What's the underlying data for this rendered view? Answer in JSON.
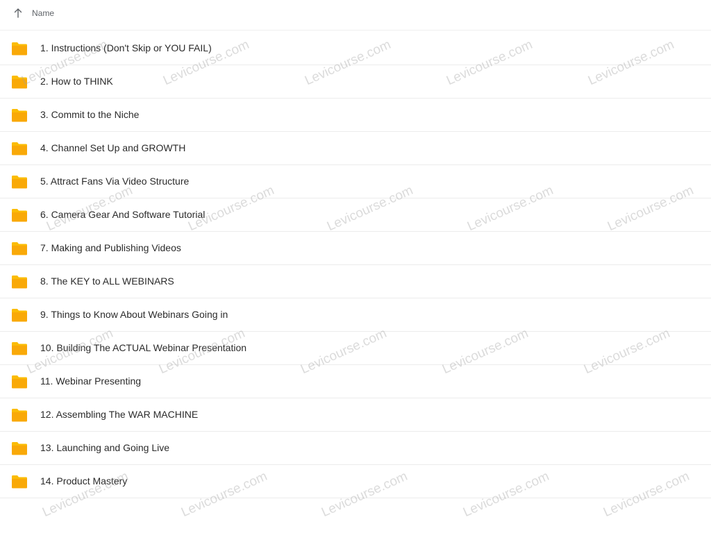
{
  "header": {
    "name_label": "Name"
  },
  "folder_color": "#fbbc05",
  "items": [
    {
      "label": "1. Instructions (Don't Skip or YOU FAIL)"
    },
    {
      "label": "2. How to THINK"
    },
    {
      "label": "3. Commit to the Niche"
    },
    {
      "label": "4. Channel Set Up and GROWTH"
    },
    {
      "label": "5. Attract Fans Via Video Structure"
    },
    {
      "label": "6. Camera Gear And Software Tutorial"
    },
    {
      "label": "7. Making and Publishing Videos"
    },
    {
      "label": "8. The KEY to ALL WEBINARS"
    },
    {
      "label": "9. Things to Know About Webinars Going in"
    },
    {
      "label": "10. Building The ACTUAL Webinar Presentation"
    },
    {
      "label": "11. Webinar Presenting"
    },
    {
      "label": "12. Assembling The WAR MACHINE"
    },
    {
      "label": "13. Launching and Going Live"
    },
    {
      "label": "14. Product Mastery"
    }
  ],
  "watermark": {
    "text": "Levicourse.com"
  }
}
